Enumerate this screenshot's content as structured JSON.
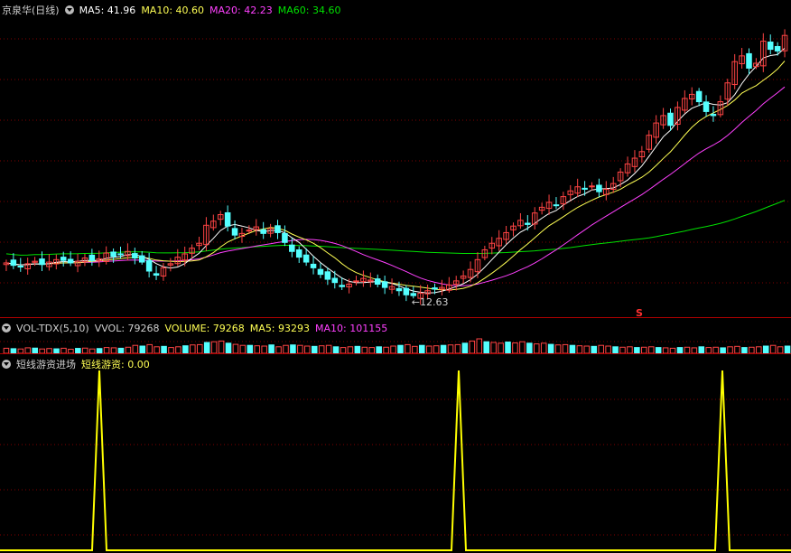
{
  "main_header": {
    "stock": "京泉华(日线)",
    "items": [
      {
        "label": "MA5: 41.96",
        "color": "#ffffff"
      },
      {
        "label": "MA10: 40.60",
        "color": "#ffff54"
      },
      {
        "label": "MA20: 42.23",
        "color": "#ff40ff"
      },
      {
        "label": "MA60: 34.60",
        "color": "#00e000"
      }
    ]
  },
  "vol_header": {
    "name": "VOL-TDX(5,10)",
    "items": [
      {
        "label": "VVOL: 79268",
        "color": "#cfcfcf"
      },
      {
        "label": "VOLUME: 79268",
        "color": "#ffff54"
      },
      {
        "label": "MA5: 93293",
        "color": "#ffff54"
      },
      {
        "label": "MA10: 101155",
        "color": "#ff40ff"
      }
    ]
  },
  "ind_header": {
    "name": "短线游资进场",
    "items": [
      {
        "label": "短线游资: 0.00",
        "color": "#ffff54"
      }
    ]
  },
  "annotations": {
    "low_label": "←12.63",
    "marker": "S"
  },
  "colors": {
    "up": "#ff4444",
    "down": "#54ffff",
    "grid": "#800000",
    "separator": "#b00000",
    "signal": "#ffff00"
  },
  "chart_data": [
    {
      "type": "candlestick",
      "title": "京泉华(日线)",
      "x": [
        1,
        2,
        3,
        4,
        5,
        6,
        7,
        8,
        9,
        10,
        11,
        12,
        13,
        14,
        15,
        16,
        17,
        18,
        19,
        20,
        21,
        22,
        23,
        24,
        25,
        26,
        27,
        28,
        29,
        30,
        31,
        32,
        33,
        34,
        35,
        36,
        37,
        38,
        39,
        40,
        41,
        42,
        43,
        44,
        45,
        46,
        47,
        48,
        49,
        50,
        51,
        52,
        53,
        54,
        55,
        56,
        57,
        58,
        59,
        60,
        61,
        62,
        63,
        64,
        65,
        66,
        67,
        68,
        69,
        70,
        71,
        72,
        73,
        74,
        75,
        76,
        77,
        78,
        79,
        80,
        81,
        82,
        83,
        84,
        85,
        86,
        87,
        88,
        89,
        90,
        91,
        92,
        93,
        94,
        95,
        96,
        97,
        98,
        99,
        100,
        101,
        102,
        103,
        104,
        105,
        106,
        107,
        108,
        109,
        110,
        111,
        112,
        113,
        114,
        115,
        116,
        117,
        118,
        119,
        120,
        121,
        122,
        123,
        124,
        125,
        126,
        127,
        128,
        129,
        130,
        131,
        132,
        133,
        134,
        135,
        136,
        137,
        138,
        139,
        140,
        141,
        142,
        143,
        144,
        145,
        146,
        147,
        148,
        149,
        150
      ],
      "close": [
        16.8,
        16.5,
        16.4,
        16.7,
        17.0,
        16.6,
        16.9,
        17.2,
        17.1,
        16.8,
        17.0,
        17.4,
        17.1,
        17.3,
        18.0,
        17.6,
        17.9,
        18.2,
        17.4,
        16.9,
        15.8,
        15.3,
        16.2,
        16.7,
        17.5,
        17.9,
        18.6,
        19.2,
        21.4,
        21.9,
        22.7,
        21.3,
        20.2,
        20.4,
        20.8,
        21.2,
        20.4,
        21.0,
        20.5,
        19.3,
        18.2,
        17.5,
        16.9,
        16.2,
        15.4,
        14.8,
        14.4,
        13.9,
        14.2,
        14.6,
        14.9,
        14.7,
        14.2,
        13.8,
        13.9,
        13.4,
        12.9,
        12.8,
        13.1,
        13.4,
        13.6,
        13.8,
        14.1,
        14.6,
        15.2,
        16.0,
        17.2,
        18.4,
        19.2,
        19.8,
        20.5,
        21.3,
        22.0,
        21.5,
        22.9,
        23.6,
        24.2,
        23.8,
        24.9,
        25.6,
        26.1,
        25.8,
        26.2,
        25.5,
        25.8,
        26.5,
        27.9,
        28.9,
        29.6,
        30.4,
        32.4,
        33.9,
        34.8,
        33.6,
        35.8,
        36.9,
        37.4,
        36.5,
        35.3,
        34.8,
        36.5,
        38.8,
        41.4,
        42.1,
        40.6,
        41.2,
        43.9,
        42.9,
        42.7,
        44.6
      ],
      "ylim": [
        10.5,
        46.5
      ],
      "annotations": [
        "←12.63",
        "S"
      ]
    },
    {
      "type": "bar",
      "title": "VOL-TDX(5,10)",
      "series": [
        {
          "name": "VOLUME",
          "values": [
            0.35,
            0.32,
            0.3,
            0.38,
            0.36,
            0.3,
            0.33,
            0.31,
            0.35,
            0.28,
            0.34,
            0.36,
            0.3,
            0.33,
            0.4,
            0.38,
            0.35,
            0.42,
            0.55,
            0.5,
            0.6,
            0.45,
            0.48,
            0.4,
            0.45,
            0.52,
            0.58,
            0.6,
            0.75,
            0.8,
            0.85,
            0.7,
            0.62,
            0.55,
            0.55,
            0.52,
            0.5,
            0.58,
            0.45,
            0.55,
            0.58,
            0.55,
            0.5,
            0.48,
            0.52,
            0.55,
            0.45,
            0.4,
            0.45,
            0.48,
            0.42,
            0.4,
            0.45,
            0.42,
            0.5,
            0.55,
            0.6,
            0.48,
            0.55,
            0.5,
            0.52,
            0.55,
            0.58,
            0.6,
            0.7,
            0.85,
            1.0,
            0.8,
            0.75,
            0.7,
            0.78,
            0.72,
            0.8,
            0.7,
            0.65,
            0.7,
            0.62,
            0.58,
            0.6,
            0.55,
            0.52,
            0.5,
            0.48,
            0.55,
            0.5,
            0.45,
            0.42,
            0.45,
            0.4,
            0.42,
            0.45,
            0.4,
            0.38,
            0.35,
            0.4,
            0.42,
            0.38,
            0.45,
            0.4,
            0.42,
            0.38,
            0.45,
            0.48,
            0.4,
            0.42,
            0.45,
            0.5,
            0.55,
            0.45,
            0.5
          ]
        }
      ]
    },
    {
      "type": "line",
      "title": "短线游资进场",
      "series": [
        {
          "name": "短线游资",
          "values": [
            0,
            0,
            0,
            0,
            0,
            0,
            0,
            0,
            0,
            0,
            0,
            0,
            0,
            0,
            0,
            0,
            0,
            0,
            0,
            0,
            0,
            0,
            0,
            0,
            0,
            0,
            1,
            0,
            0,
            0,
            0,
            0,
            0,
            0,
            0,
            0,
            0,
            0,
            0,
            0,
            0,
            0,
            0,
            0,
            0,
            0,
            0,
            0,
            0,
            0,
            0,
            0,
            0,
            0,
            0,
            0,
            0,
            0,
            0,
            0,
            0,
            0,
            0,
            0,
            0,
            0,
            0,
            0,
            0,
            0,
            0,
            0,
            0,
            0,
            0,
            0,
            0,
            0,
            0,
            0,
            0,
            0,
            0,
            0,
            0,
            0,
            0,
            0,
            0,
            0,
            0,
            0,
            0,
            0,
            0,
            0,
            0,
            0,
            0,
            0,
            0,
            0,
            0,
            0,
            0,
            0,
            0,
            0,
            0,
            0,
            0,
            0,
            0,
            0,
            0,
            0,
            0,
            0,
            0,
            0,
            0,
            0,
            0,
            0,
            0,
            0,
            0,
            0,
            0,
            0,
            0,
            0,
            0,
            0,
            0,
            0,
            0,
            0,
            0,
            0,
            0,
            0,
            0,
            0,
            0,
            0,
            0,
            0,
            0,
            0
          ]
        }
      ],
      "signal_indices": [
        26,
        125,
        198
      ],
      "ylim": [
        0,
        1
      ]
    }
  ]
}
